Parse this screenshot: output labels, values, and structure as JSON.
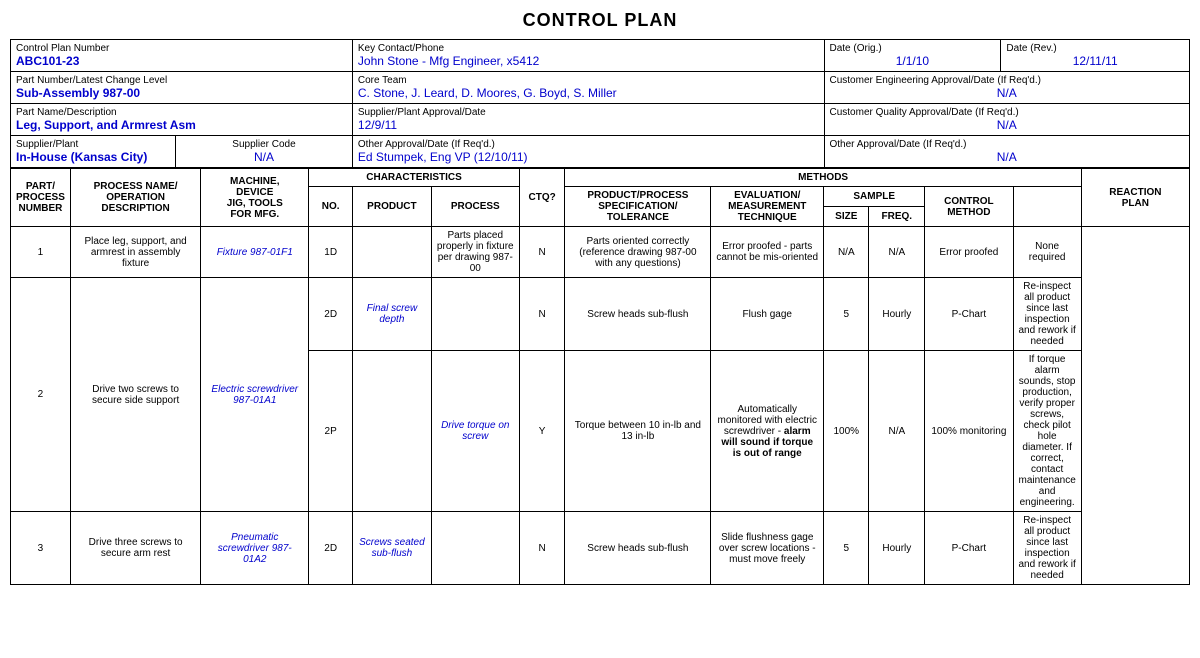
{
  "title": "CONTROL PLAN",
  "header": {
    "control_plan_label": "Control Plan Number",
    "control_plan_number": "ABC101-23",
    "key_contact_label": "Key Contact/Phone",
    "key_contact_value": "John Stone - Mfg Engineer, x5412",
    "date_orig_label": "Date (Orig.)",
    "date_orig_value": "1/1/10",
    "date_rev_label": "Date (Rev.)",
    "date_rev_value": "12/11/11",
    "part_number_label": "Part Number/Latest Change Level",
    "part_number_value": "Sub-Assembly 987-00",
    "core_team_label": "Core Team",
    "core_team_value": "C. Stone, J. Leard, D. Moores, G. Boyd, S. Miller",
    "cust_eng_label": "Customer Engineering Approval/Date (If Req'd.)",
    "cust_eng_value": "N/A",
    "part_name_label": "Part Name/Description",
    "part_name_value": "Leg, Support, and Armrest Asm",
    "supplier_plant_approval_label": "Supplier/Plant Approval/Date",
    "supplier_plant_approval_value": "12/9/11",
    "cust_quality_label": "Customer Quality Approval/Date (If Req'd.)",
    "cust_quality_value": "N/A",
    "supplier_plant_label": "Supplier/Plant",
    "supplier_plant_value": "In-House (Kansas City)",
    "supplier_code_label": "Supplier Code",
    "supplier_code_value": "N/A",
    "other_approval_label": "Other Approval/Date (If Req'd.)",
    "other_approval_value": "Ed Stumpek, Eng VP (12/10/11)",
    "other_approval2_label": "Other Approval/Date (If Req'd.)",
    "other_approval2_value": "N/A"
  },
  "table": {
    "col_headers": {
      "part_process": "PART/ PROCESS NUMBER",
      "process_name": "PROCESS NAME/ OPERATION DESCRIPTION",
      "machine": "MACHINE, DEVICE JIG, TOOLS FOR MFG.",
      "no": "NO.",
      "product": "PRODUCT",
      "process": "PROCESS",
      "ctq": "CTQ?",
      "prod_spec": "PRODUCT/PROCESS SPECIFICATION/ TOLERANCE",
      "eval": "EVALUATION/ MEASUREMENT TECHNIQUE",
      "size": "SIZE",
      "freq": "FREQ.",
      "control_method": "CONTROL METHOD",
      "reaction_plan": "REACTION PLAN",
      "characteristics": "CHARACTERISTICS",
      "methods": "METHODS",
      "sample": "SAMPLE"
    },
    "rows": [
      {
        "part_number": "1",
        "process_name": "Place leg, support, and armrest in assembly fixture",
        "machine": "Fixture 987-01F1",
        "no": "1D",
        "product": "",
        "process": "Parts placed properly in fixture per drawing 987-00",
        "ctq": "N",
        "prod_spec": "Parts oriented correctly (reference drawing 987-00 with any questions)",
        "eval": "Error proofed - parts cannot be mis-oriented",
        "size": "N/A",
        "freq": "N/A",
        "control_method": "Error proofed",
        "reaction_plan": "None required"
      },
      {
        "part_number": "2",
        "process_name": "Drive two screws to secure side support",
        "machine": "Electric screwdriver 987-01A1",
        "no": "2D",
        "product": "Final screw depth",
        "process": "",
        "ctq": "N",
        "prod_spec": "Screw heads sub-flush",
        "eval": "Flush gage",
        "size": "5",
        "freq": "Hourly",
        "control_method": "P-Chart",
        "reaction_plan": "Re-inspect all product since last inspection and rework if needed"
      },
      {
        "part_number": "",
        "process_name": "",
        "machine": "",
        "no": "2P",
        "product": "",
        "process": "Drive torque on screw",
        "ctq": "Y",
        "prod_spec": "Torque between 10 in-lb and 13 in-lb",
        "eval": "Automatically monitored with electric screwdriver - alarm will sound if torque is out of range",
        "size": "100%",
        "freq": "N/A",
        "control_method": "100% monitoring",
        "reaction_plan": "If torque alarm sounds, stop production, verify proper screws, check pilot hole diameter.  If correct, contact maintenance and engineering."
      },
      {
        "part_number": "3",
        "process_name": "Drive three screws to secure arm rest",
        "machine": "Pneumatic screwdriver 987-01A2",
        "no": "2D",
        "product": "Screws seated sub-flush",
        "process": "",
        "ctq": "N",
        "prod_spec": "Screw heads sub-flush",
        "eval": "Slide flushness gage over screw locations - must move freely",
        "size": "5",
        "freq": "Hourly",
        "control_method": "P-Chart",
        "reaction_plan": "Re-inspect all product since last inspection and rework if needed"
      }
    ]
  }
}
